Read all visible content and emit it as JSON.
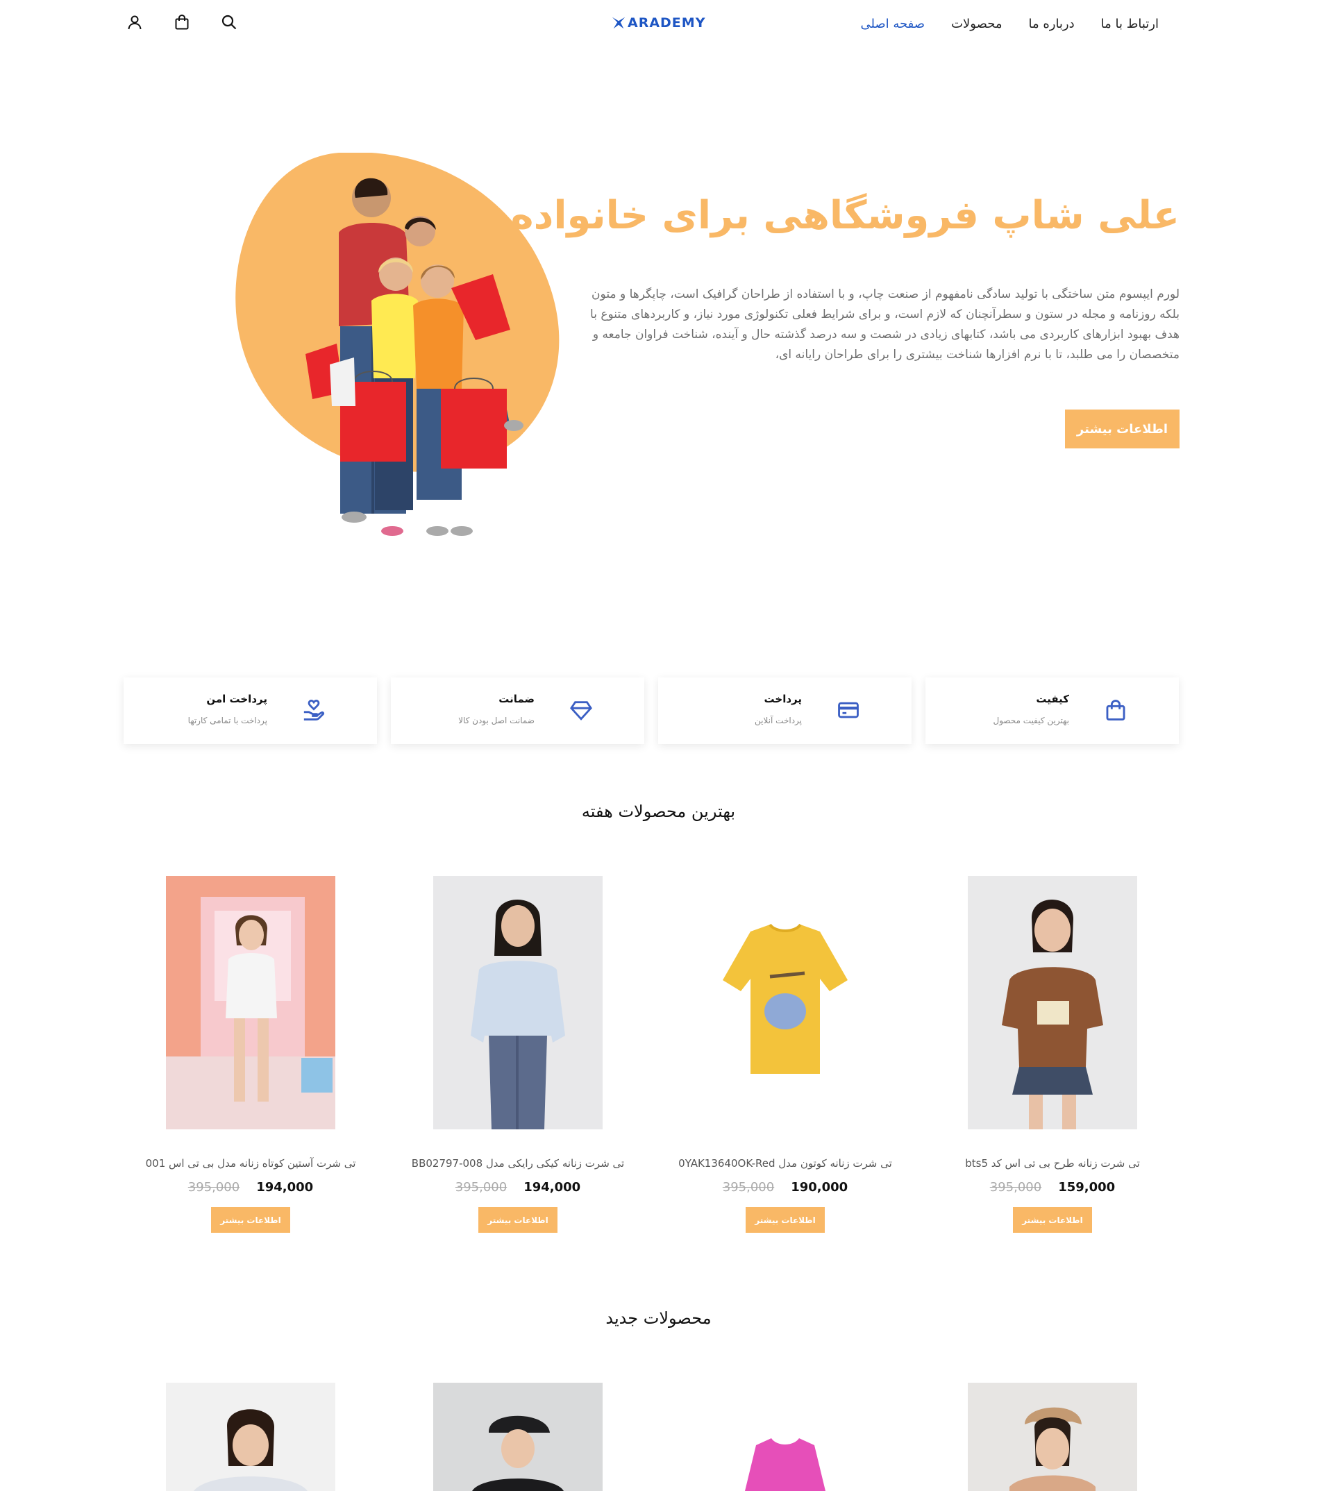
{
  "header": {
    "logo_text": "ARADEMY",
    "nav": [
      {
        "label": "صفحه اصلی",
        "active": true
      },
      {
        "label": "محصولات",
        "active": false
      },
      {
        "label": "درباره ما",
        "active": false
      },
      {
        "label": "ارتباط با ما",
        "active": false
      }
    ],
    "icons": [
      "user-icon",
      "shopping-bag-icon",
      "search-icon"
    ]
  },
  "hero": {
    "title": "علی شاپ فروشگاهی برای خانواده",
    "text": "لورم ایپسوم متن ساختگی با تولید سادگی نامفهوم از صنعت چاپ، و با استفاده از طراحان گرافیک است، چاپگرها و متون بلکه روزنامه و مجله در ستون و سطرآنچنان که لازم است، و برای شرایط فعلی تکنولوژی مورد نیاز، و کاربردهای متنوع با هدف بهبود ابزارهای کاربردی می باشد، کتابهای زیادی در شصت و سه درصد گذشته حال و آینده، شناخت فراوان جامعه و متخصصان را می طلبد، تا با نرم افزارها شناخت بیشتری را برای طراحان رایانه ای،",
    "button_label": "اطلاعات بیشتر"
  },
  "features": [
    {
      "title": "کیفیت",
      "subtitle": "بهترین کیفیت محصول",
      "icon": "shopping-bag-icon"
    },
    {
      "title": "پرداخت",
      "subtitle": "پرداخت آنلاین",
      "icon": "credit-card-icon"
    },
    {
      "title": "ضمانت",
      "subtitle": "ضمانت اصل بودن کالا",
      "icon": "diamond-icon"
    },
    {
      "title": "پرداخت امن",
      "subtitle": "پرداخت با تمامی کارتها",
      "icon": "hand-heart-icon"
    }
  ],
  "best_products": {
    "title": "بهترین محصولات هفته",
    "items": [
      {
        "name": "تی شرت زنانه طرح بی تی اس کد bts5",
        "price": "159,000",
        "old_price": "395,000",
        "button_label": "اطلاعات بیشتر"
      },
      {
        "name": "تی شرت زنانه کوتون مدل 0YAK13640OK-Red",
        "price": "190,000",
        "old_price": "395,000",
        "button_label": "اطلاعات بیشتر"
      },
      {
        "name": "تی شرت زنانه کیکی رایکی مدل BB02797-008",
        "price": "194,000",
        "old_price": "395,000",
        "button_label": "اطلاعات بیشتر"
      },
      {
        "name": "تی شرت آستین کوتاه زنانه مدل بی تی اس 001",
        "price": "194,000",
        "old_price": "395,000",
        "button_label": "اطلاعات بیشتر"
      }
    ]
  },
  "new_products": {
    "title": "محصولات جدید"
  },
  "colors": {
    "accent": "#f9b866",
    "brand_blue": "#1e56c4",
    "icon_blue": "#3b5fc4"
  }
}
